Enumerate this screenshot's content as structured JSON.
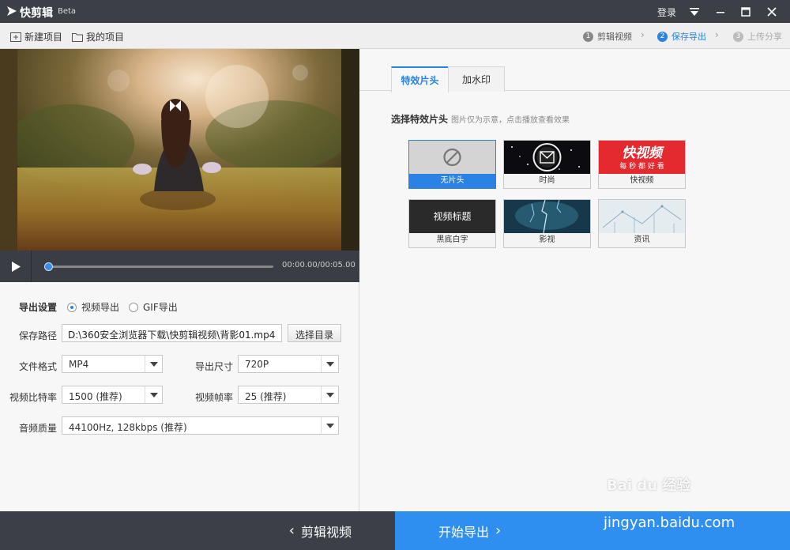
{
  "titlebar": {
    "app_name": "快剪辑",
    "beta": "Beta",
    "login": "登录"
  },
  "toolbar": {
    "new_project": "新建项目",
    "my_projects": "我的项目",
    "steps": [
      {
        "num": "1",
        "label": "剪辑视频"
      },
      {
        "num": "2",
        "label": "保存导出"
      },
      {
        "num": "3",
        "label": "上传分享"
      }
    ]
  },
  "player": {
    "time": "00:00.00/00:05.00",
    "progress": 0
  },
  "export": {
    "settings_label": "导出设置",
    "radio_video": "视频导出",
    "radio_gif": "GIF导出",
    "save_path_label": "保存路径",
    "save_path_value": "D:\\360安全浏览器下载\\快剪辑视频\\背影01.mp4",
    "browse_button": "选择目录",
    "format_label": "文件格式",
    "format_value": "MP4",
    "size_label": "导出尺寸",
    "size_value": "720P",
    "bitrate_label": "视频比特率",
    "bitrate_value": "1500 (推荐)",
    "framerate_label": "视频帧率",
    "framerate_value": "25 (推荐)",
    "audio_label": "音频质量",
    "audio_value": "44100Hz, 128kbps (推荐)"
  },
  "right": {
    "tabs": [
      "特效片头",
      "加水印"
    ],
    "section_title": "选择特效片头",
    "section_hint": "图片仅为示意，点击播放查看效果",
    "intros": [
      {
        "label": "无片头"
      },
      {
        "label": "时尚"
      },
      {
        "label": "快视频",
        "img_text": "快视频",
        "img_sub": "每 秒 都 好 看"
      },
      {
        "label": "黑底白字",
        "img_text": "视频标题"
      },
      {
        "label": "影视"
      },
      {
        "label": "资讯"
      }
    ]
  },
  "bottom": {
    "edit_video": "剪辑视频",
    "start_export": "开始导出"
  },
  "watermark": {
    "logo": "Bai du 经验",
    "url": "jingyan.baidu.com"
  },
  "colors": {
    "accent": "#2a82e4",
    "title_bar": "#3c3f46",
    "export_button": "#2f8ff0"
  }
}
